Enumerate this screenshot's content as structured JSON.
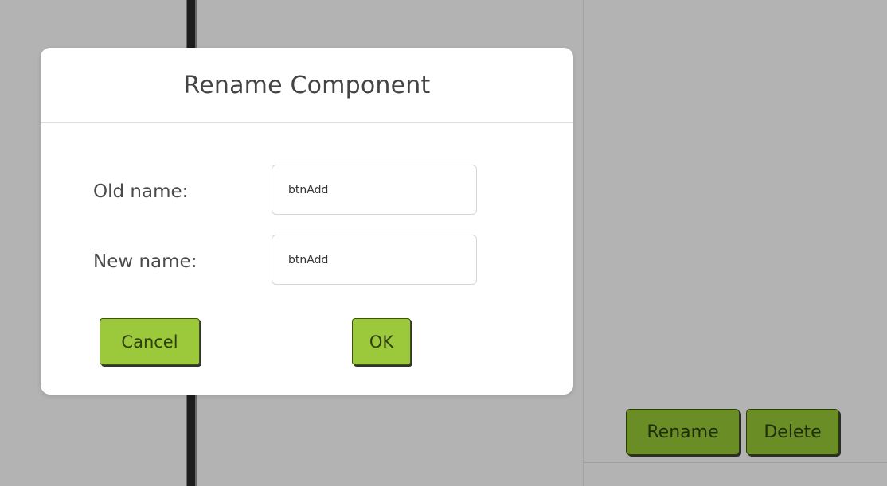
{
  "colors": {
    "page_background": "#b3b3b3",
    "dialog_background": "#ffffff",
    "dialog_button_green": "#9cc93b",
    "panel_button_green": "#6a8d26"
  },
  "dialog": {
    "title": "Rename Component",
    "old_name_label": "Old name:",
    "old_name_value": "btnAdd",
    "new_name_label": "New name:",
    "new_name_value": "btnAdd",
    "cancel_label": "Cancel",
    "ok_label": "OK"
  },
  "panel": {
    "rename_label": "Rename",
    "delete_label": "Delete"
  }
}
